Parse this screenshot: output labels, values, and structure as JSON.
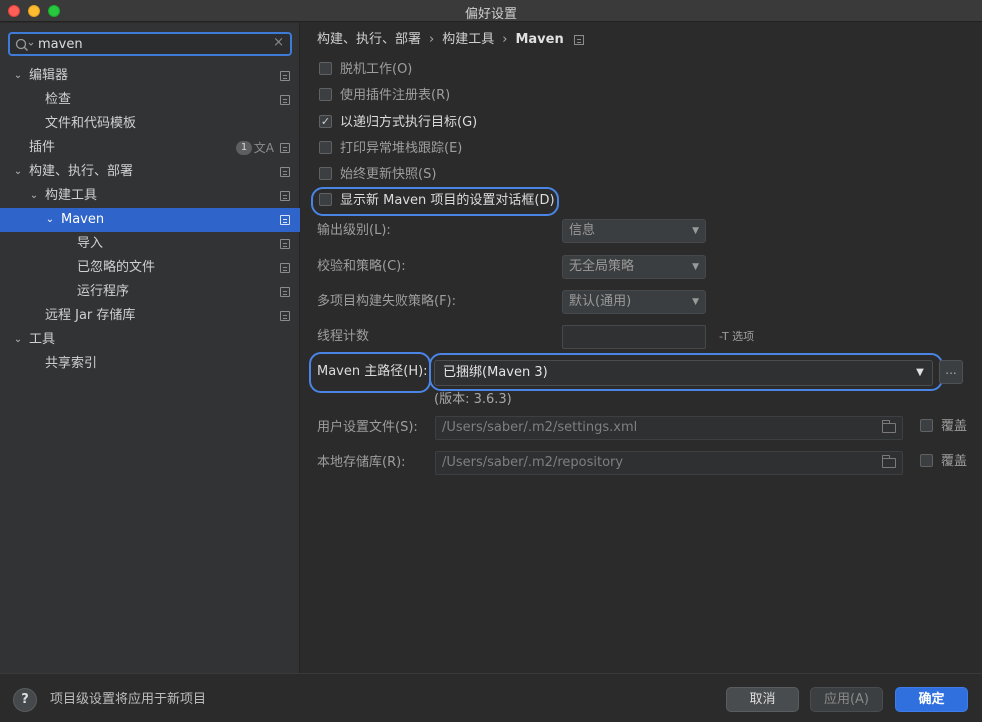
{
  "window": {
    "title": "偏好设置"
  },
  "search": {
    "value": "maven",
    "placeholder": ""
  },
  "sidebar": {
    "items": [
      {
        "label": "编辑器",
        "arrow": "⌄"
      },
      {
        "label": "检查"
      },
      {
        "label": "文件和代码模板"
      },
      {
        "label": "插件",
        "badge": "1"
      },
      {
        "label": "构建、执行、部署",
        "arrow": "⌄"
      },
      {
        "label": "构建工具",
        "arrow": "⌄"
      },
      {
        "label": "Maven",
        "arrow": "⌄"
      },
      {
        "label": "导入"
      },
      {
        "label": "已忽略的文件"
      },
      {
        "label": "运行程序"
      },
      {
        "label": "远程 Jar 存储库"
      },
      {
        "label": "工具",
        "arrow": "⌄"
      },
      {
        "label": "共享索引"
      }
    ]
  },
  "breadcrumb": {
    "part1": "构建、执行、部署",
    "part2": "构建工具",
    "part3": "Maven",
    "sep": "›"
  },
  "checkboxes": [
    {
      "label": "脱机工作(O)"
    },
    {
      "label": "使用插件注册表(R)"
    },
    {
      "label": "以递归方式执行目标(G)",
      "mark": "✓"
    },
    {
      "label": "打印异常堆栈跟踪(E)"
    },
    {
      "label": "始终更新快照(S)"
    },
    {
      "label": "显示新 Maven 项目的设置对话框(D)"
    }
  ],
  "settings": {
    "output_level_label": "输出级别(L):",
    "output_level_value": "信息",
    "checksum_label": "校验和策略(C):",
    "checksum_value": "无全局策略",
    "multiproject_label": "多项目构建失败策略(F):",
    "multiproject_value": "默认(通用)",
    "thread_label": "线程计数",
    "thread_value": "",
    "thread_hint": "-T 选项",
    "maven_home_label": "Maven 主路径(H):",
    "maven_home_value": "已捆绑(Maven 3)",
    "ellipsis": "...",
    "version": "(版本: 3.6.3)",
    "user_settings_label": "用户设置文件(S):",
    "user_settings_value": "/Users/saber/.m2/settings.xml",
    "local_repo_label": "本地存储库(R):",
    "local_repo_value": "/Users/saber/.m2/repository",
    "override_label": "覆盖"
  },
  "footer": {
    "help": "?",
    "note": "项目级设置将应用于新项目",
    "cancel": "取消",
    "apply": "应用(A)",
    "ok": "确定"
  },
  "colors": {
    "accent": "#2f65ca",
    "highlight_ring": "#4a85e6",
    "ok_button": "#2f6fde"
  }
}
